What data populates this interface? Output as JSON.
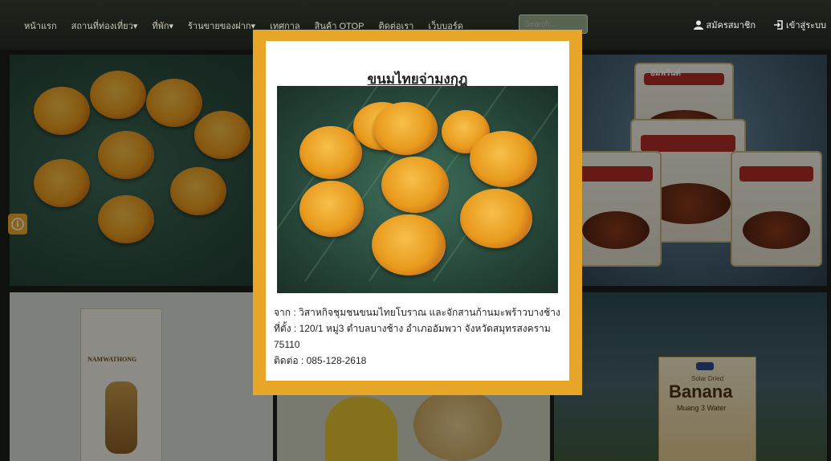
{
  "nav": {
    "items": [
      "หน้าแรก",
      "สถานที่ท่องเที่ยว▾",
      "ที่พัก▾",
      "ร้านขายของฝาก▾",
      "เทศกาล",
      "สินค้า OTOP",
      "ติดต่อเรา",
      "เว็บบอร์ด"
    ],
    "search_placeholder": "Search...",
    "register_label": "สมัครสมาชิก",
    "login_label": "เข้าสู่ระบบ"
  },
  "modal": {
    "title": "ขนมไทยจ่ามงกุฎ",
    "from_line": "จาก : วิสาหกิจชุมชนขนมไทยโบราณ และจักสานก้านมะพร้าวบางช้าง",
    "address_line": "ที่ตั้ง : 120/1 หมู่3 ตำบลบางช้าง อำเภออัมพวา จังหวัดสมุทรสงคราม",
    "postcode": "75110",
    "contact_line": "ติดต่อ : 085-128-2618"
  },
  "tiles": {
    "product1_brand": "NAMWATHONG",
    "product2_brand": "Banana",
    "product2_sub": "Muang 3 Water",
    "product2_tag": "Solar Dried",
    "product3_brand": "อัมพรันต์"
  },
  "colors": {
    "modal_frame": "#e8a628",
    "info_badge": "#f0a92e",
    "navbar": "#1f241d"
  }
}
